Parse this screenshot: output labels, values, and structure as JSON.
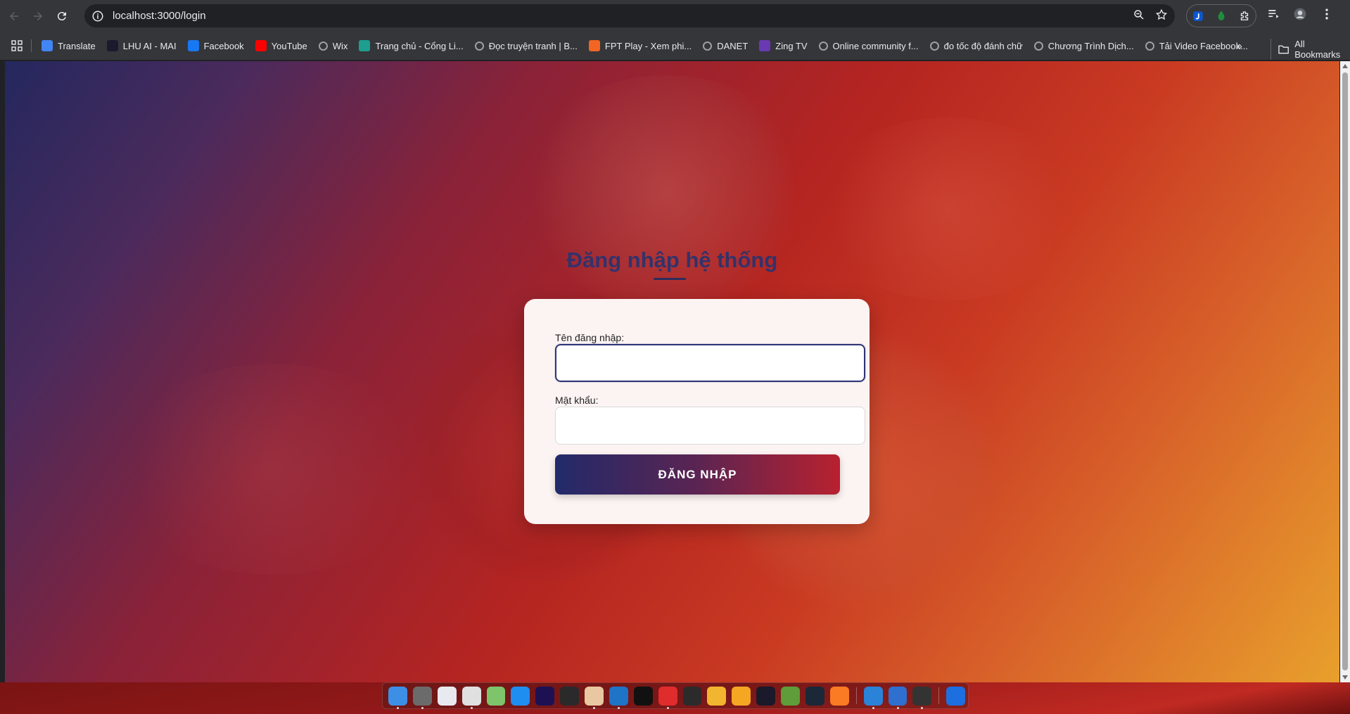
{
  "browser": {
    "url": "localhost:3000/login",
    "bookmarks": [
      {
        "label": "Translate",
        "icon": "google-translate-icon",
        "color": "#4285f4"
      },
      {
        "label": "LHU AI - MAI",
        "icon": "lhu-ai-icon",
        "color": "#1a1a2e"
      },
      {
        "label": "Facebook",
        "icon": "facebook-icon",
        "color": "#1877f2"
      },
      {
        "label": "YouTube",
        "icon": "youtube-icon",
        "color": "#ff0000"
      },
      {
        "label": "Wix",
        "icon": "globe-icon",
        "color": "#9aa0a6"
      },
      {
        "label": "Trang chủ - Cổng Li...",
        "icon": "portal-icon",
        "color": "#1e9e8e"
      },
      {
        "label": "Đọc truyện tranh | B...",
        "icon": "globe-icon",
        "color": "#9aa0a6"
      },
      {
        "label": "FPT Play - Xem phi...",
        "icon": "fpt-play-icon",
        "color": "#f26522"
      },
      {
        "label": "DANET",
        "icon": "globe-icon",
        "color": "#9aa0a6"
      },
      {
        "label": "Zing TV",
        "icon": "zing-tv-icon",
        "color": "#6a3ab2"
      },
      {
        "label": "Online community f...",
        "icon": "globe-icon",
        "color": "#9aa0a6"
      },
      {
        "label": "đo tốc độ đánh chữ",
        "icon": "globe-icon",
        "color": "#9aa0a6"
      },
      {
        "label": "Chương Trình Dịch...",
        "icon": "globe-icon",
        "color": "#9aa0a6"
      },
      {
        "label": "Tải Video Facebook...",
        "icon": "globe-icon",
        "color": "#9aa0a6"
      }
    ],
    "more_bookmarks": "»",
    "all_bookmarks": "All Bookmarks"
  },
  "login": {
    "title": "Đăng nhập hệ thống",
    "username_label": "Tên đăng nhập:",
    "username_value": "",
    "password_label": "Mật khẩu:",
    "password_value": "",
    "submit_label": "ĐĂNG NHẬP"
  },
  "colors": {
    "title": "#34326a",
    "button_start": "#222a6a",
    "button_end": "#b8212f",
    "card_bg": "#fcf4f3"
  },
  "dock": [
    {
      "icon": "finder-icon",
      "color": "#3d8fe6",
      "running": true
    },
    {
      "icon": "settings-icon",
      "color": "#6b6b6b",
      "running": true
    },
    {
      "icon": "launchpad-icon",
      "color": "#e9e9f0",
      "running": false
    },
    {
      "icon": "chrome-icon",
      "color": "#e0e0e0",
      "running": true
    },
    {
      "icon": "maps-icon",
      "color": "#7ec46a",
      "running": false
    },
    {
      "icon": "zalo-icon",
      "color": "#1f8ef1",
      "running": false
    },
    {
      "icon": "premiere-icon",
      "color": "#1d1153",
      "running": false
    },
    {
      "icon": "resolve-icon",
      "color": "#2a2a2a",
      "running": false
    },
    {
      "icon": "preview-icon",
      "color": "#e9c7a0",
      "running": true
    },
    {
      "icon": "vscode-icon",
      "color": "#1e74c6",
      "running": true
    },
    {
      "icon": "capcut-icon",
      "color": "#111111",
      "running": false
    },
    {
      "icon": "red-app-icon",
      "color": "#e02c2c",
      "running": true
    },
    {
      "icon": "terminal-app-icon",
      "color": "#2b2b2b",
      "running": false
    },
    {
      "icon": "robot-app-icon",
      "color": "#f2b52f",
      "running": false
    },
    {
      "icon": "counter-strike-icon",
      "color": "#f5a623",
      "running": false
    },
    {
      "icon": "valorant-icon",
      "color": "#1a1a2a",
      "running": false
    },
    {
      "icon": "minecraft-icon",
      "color": "#5e9d3a",
      "running": false
    },
    {
      "icon": "steam-icon",
      "color": "#1b2838",
      "running": false
    },
    {
      "icon": "xampp-icon",
      "color": "#fb7a24",
      "running": false
    },
    {
      "icon": "document-app-icon",
      "color": "#2b82d9",
      "running": true
    },
    {
      "icon": "presentation-app-icon",
      "color": "#2e6fcf",
      "running": true
    },
    {
      "icon": "console-icon",
      "color": "#333333",
      "running": true
    },
    {
      "icon": "windows-icon",
      "color": "#1d6fe0",
      "running": false
    }
  ]
}
